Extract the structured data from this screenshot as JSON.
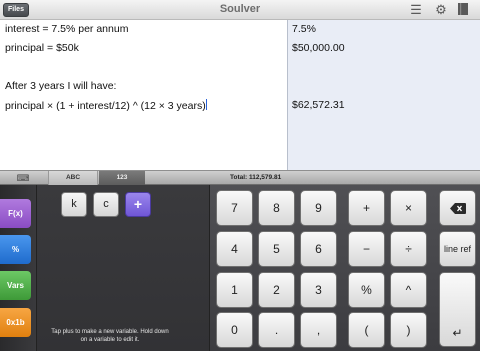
{
  "titlebar": {
    "files_label": "Files",
    "title": "Soulver",
    "icons": [
      "list-icon",
      "gear-icon",
      "book-icon"
    ]
  },
  "editor": {
    "lines": [
      "interest = 7.5% per annum",
      "principal = $50k",
      "",
      "After 3 years I will have:",
      "principal × (1 + interest/12) ^ (12 × 3 years)"
    ]
  },
  "results": [
    "7.5%",
    "$50,000.00",
    "",
    "",
    "$62,572.31"
  ],
  "tabstrip": {
    "tab_abc": "ABC",
    "tab_123": "123",
    "total": "Total:  112,579.81"
  },
  "sidebar": {
    "buttons": [
      {
        "label": "F(x)",
        "color": "#9d5fd0"
      },
      {
        "label": "%",
        "color": "#2e7fe0"
      },
      {
        "label": "Vars",
        "color": "#4fb24a"
      },
      {
        "label": "0x1b",
        "color": "#f0901e"
      }
    ]
  },
  "vars": {
    "keys": [
      "k",
      "c",
      "+"
    ],
    "hint": "Tap plus to make a new variable. Hold down on a variable to edit it."
  },
  "numpad": {
    "row1": [
      "7",
      "8",
      "9",
      "+",
      "×",
      "⌫"
    ],
    "row2": [
      "4",
      "5",
      "6",
      "−",
      "÷",
      "line ref"
    ],
    "row3": [
      "1",
      "2",
      "3",
      "%",
      "^"
    ],
    "row4": [
      "0",
      ".",
      ",",
      "(",
      ")"
    ],
    "enter": "↵"
  }
}
